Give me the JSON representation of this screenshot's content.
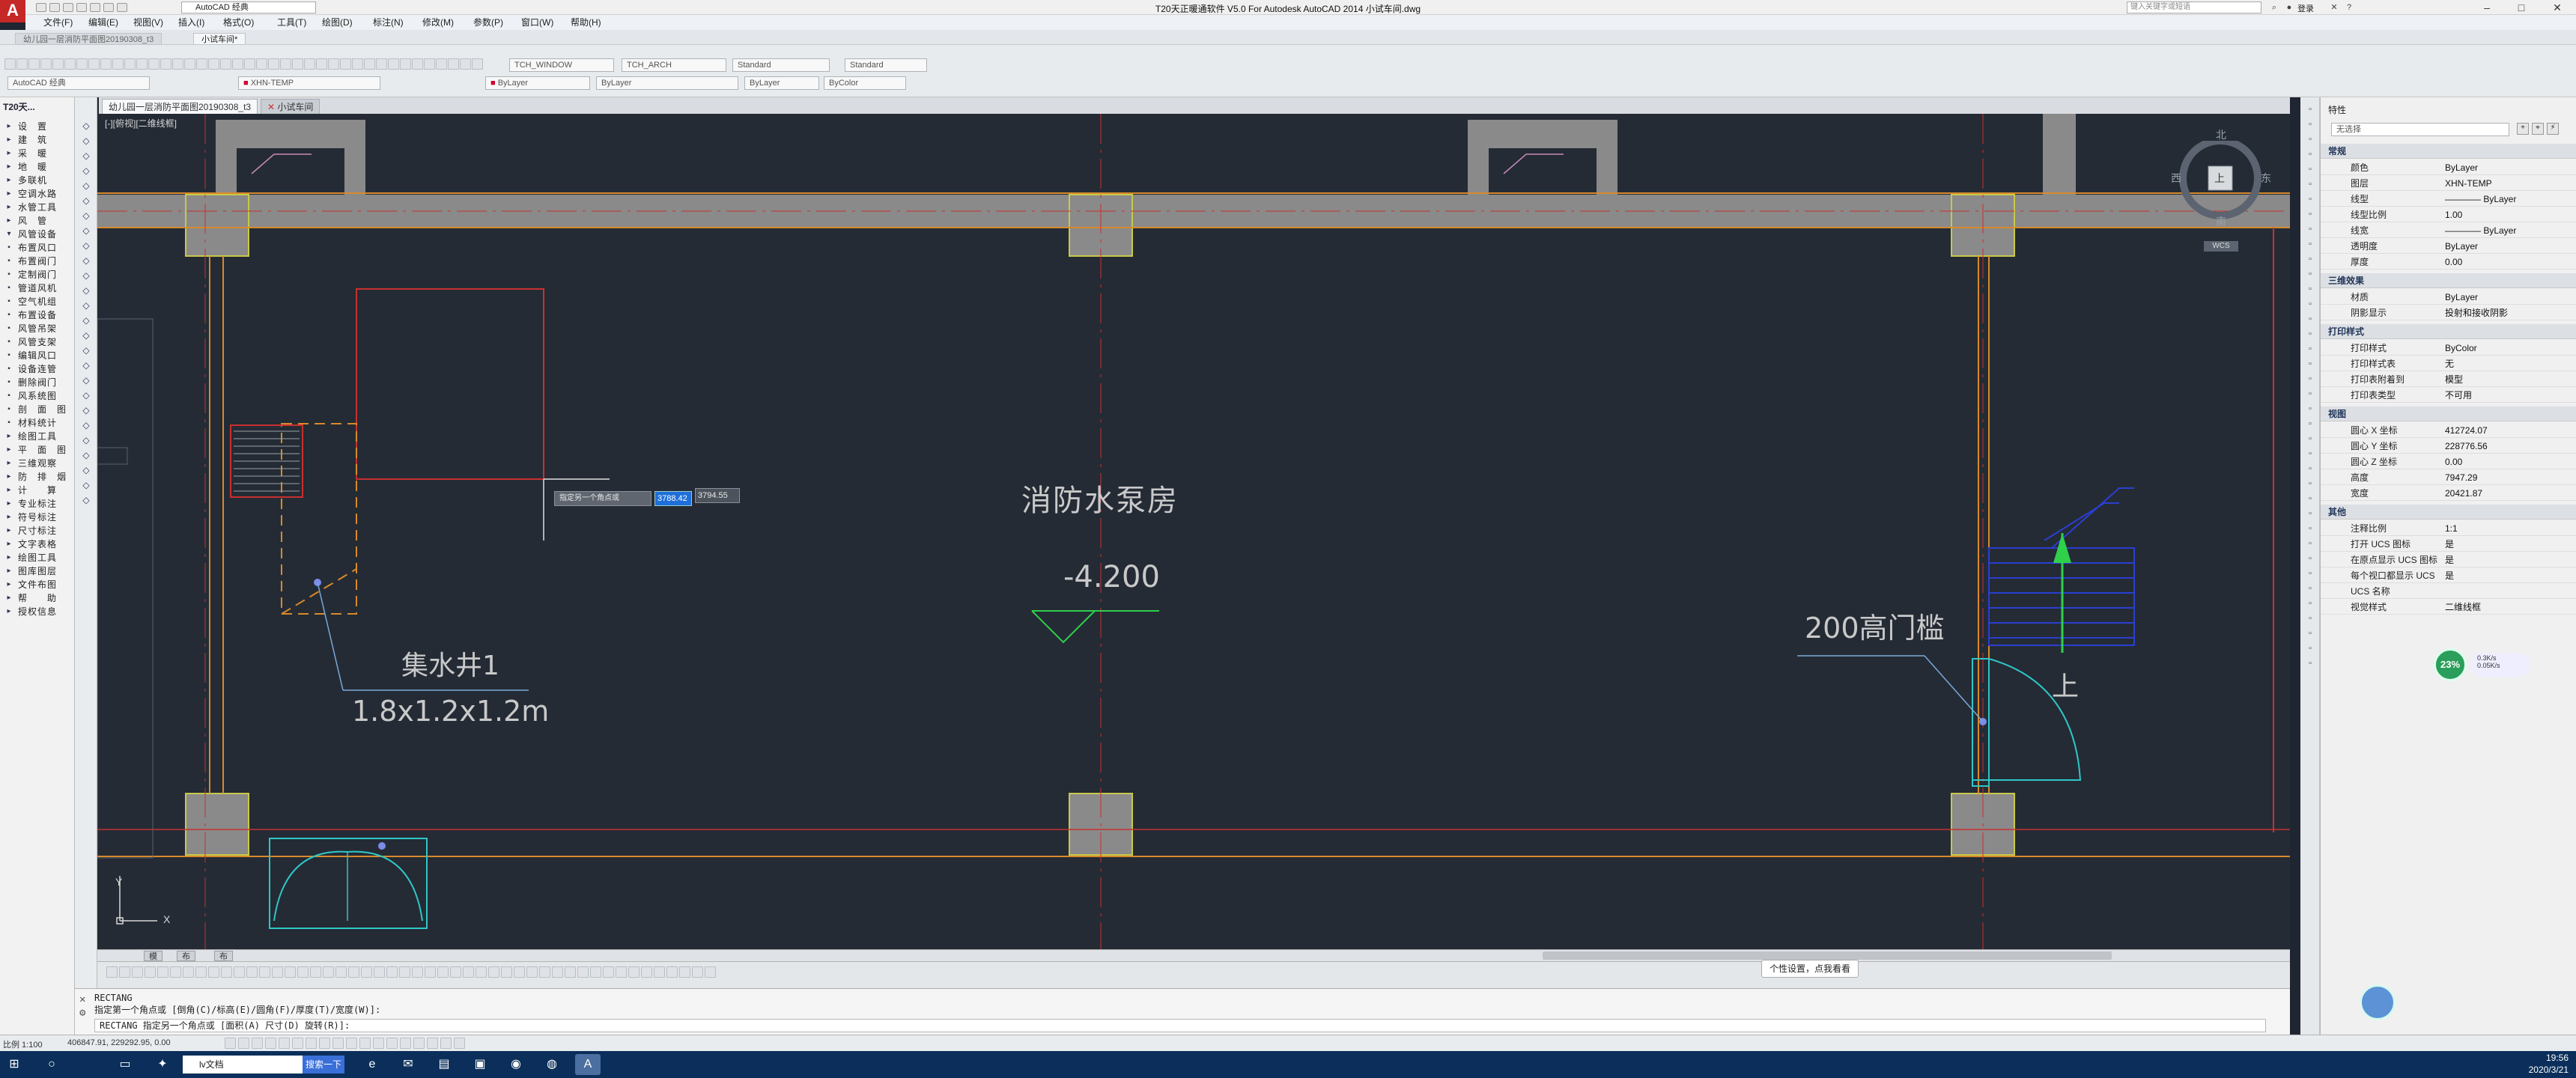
{
  "titlebar": {
    "app_label": "A",
    "workspace": "AutoCAD 经典",
    "title": "T20天正暖通软件 V5.0 For Autodesk AutoCAD 2014   小试车间.dwg",
    "search_placeholder": "键入关键字或短语",
    "sign_in": "登录"
  },
  "menu": [
    "文件(F)",
    "编辑(E)",
    "视图(V)",
    "插入(I)",
    "格式(O)",
    "工具(T)",
    "绘图(D)",
    "标注(N)",
    "修改(M)",
    "参数(P)",
    "窗口(W)",
    "帮助(H)"
  ],
  "file_tabs": [
    {
      "label": "幼儿园一层消防平面图20190308_t3",
      "active": false
    },
    {
      "label": "小试车间*",
      "active": true
    }
  ],
  "toolbars": {
    "workspace_dropdown": "AutoCAD 经典",
    "layer_dropdown": "XHN-TEMP",
    "textstyle_window": "TCH_WINDOW",
    "textstyle_arch": "TCH_ARCH",
    "dimstyle": "Standard",
    "tablestyle": "Standard",
    "color": "ByLayer",
    "linetype": "ByLayer",
    "lineweight": "ByLayer",
    "plotstyle": "ByColor"
  },
  "doc_tabs": [
    {
      "label": "幼儿园一层消防平面图20190308_t3",
      "active": true
    },
    {
      "label": "小试车间",
      "active": false
    }
  ],
  "left_panel": {
    "title": "T20天...",
    "items": [
      {
        "icon": "▸",
        "label": "设　置"
      },
      {
        "icon": "▸",
        "label": "建　筑"
      },
      {
        "icon": "▸",
        "label": "采　暖"
      },
      {
        "icon": "▸",
        "label": "地　暖"
      },
      {
        "icon": "▸",
        "label": "多联机"
      },
      {
        "icon": "▸",
        "label": "空调水路"
      },
      {
        "icon": "▸",
        "label": "水管工具"
      },
      {
        "icon": "▸",
        "label": "风　管"
      },
      {
        "icon": "▾",
        "label": "风管设备"
      },
      {
        "icon": "▪",
        "label": "布置风口"
      },
      {
        "icon": "▪",
        "label": "布置阀门"
      },
      {
        "icon": "▪",
        "label": "定制阀门"
      },
      {
        "icon": "▪",
        "label": "管道风机"
      },
      {
        "icon": "▪",
        "label": "空气机组"
      },
      {
        "icon": "▪",
        "label": "布置设备"
      },
      {
        "icon": "▪",
        "label": "风管吊架"
      },
      {
        "icon": "▪",
        "label": "风管支架"
      },
      {
        "icon": "▪",
        "label": "编辑风口"
      },
      {
        "icon": "▪",
        "label": "设备连管"
      },
      {
        "icon": "▪",
        "label": "删除阀门"
      },
      {
        "icon": "▪",
        "label": "风系统图"
      },
      {
        "icon": "▪",
        "label": "剖　面　图"
      },
      {
        "icon": "▪",
        "label": "材料统计"
      },
      {
        "icon": "▸",
        "label": "绘图工具"
      },
      {
        "icon": "▸",
        "label": "平　面　图"
      },
      {
        "icon": "▸",
        "label": "三维观察"
      },
      {
        "icon": "▸",
        "label": "防　排　烟"
      },
      {
        "icon": "▸",
        "label": "计　　算"
      },
      {
        "icon": "▸",
        "label": "专业标注"
      },
      {
        "icon": "▸",
        "label": "符号标注"
      },
      {
        "icon": "▸",
        "label": "尺寸标注"
      },
      {
        "icon": "▸",
        "label": "文字表格"
      },
      {
        "icon": "▸",
        "label": "绘图工具"
      },
      {
        "icon": "▸",
        "label": "图库图层"
      },
      {
        "icon": "▸",
        "label": "文件布图"
      },
      {
        "icon": "▸",
        "label": "帮　　助"
      },
      {
        "icon": "▸",
        "label": "授权信息"
      }
    ]
  },
  "canvas": {
    "view_label": "[-][俯视][二维线框]",
    "labels": {
      "room": "消防水泵房",
      "elevation": "-4.200",
      "pit_name": "集水井1",
      "pit_size": "1.8x1.2x1.2m",
      "threshold": "200高门槛",
      "stair_up": "上"
    },
    "dynamic_input": {
      "prompt": "指定另一个角点或",
      "x_value": "3788.42",
      "y_value": "3794.55"
    },
    "viewcube": {
      "north": "北",
      "south": "南",
      "east": "东",
      "west": "西",
      "top": "上",
      "wcs": "WCS"
    },
    "ucs": {
      "x": "X",
      "y": "Y"
    }
  },
  "layout_tabs": [
    "模型",
    "布局1",
    "布局2"
  ],
  "command": {
    "line1": "RECTANG",
    "line2": "指定第一个角点或 [倒角(C)/标高(E)/圆角(F)/厚度(T)/宽度(W)]:",
    "prompt_prefix": "RECTANG 指定另一个角点或 [面积(A) 尺寸(D) 旋转(R)]:"
  },
  "status": {
    "scale": "比例 1:100",
    "coords": "406847.91, 229292.95, 0.00",
    "hint_chip": "个性设置，点我看看"
  },
  "properties": {
    "selection": "无选择",
    "sections": [
      {
        "title": "常规",
        "rows": [
          [
            "颜色",
            "ByLayer"
          ],
          [
            "图层",
            "XHN-TEMP"
          ],
          [
            "线型",
            "———— ByLayer"
          ],
          [
            "线型比例",
            "1.00"
          ],
          [
            "线宽",
            "———— ByLayer"
          ],
          [
            "透明度",
            "ByLayer"
          ],
          [
            "厚度",
            "0.00"
          ]
        ]
      },
      {
        "title": "三维效果",
        "rows": [
          [
            "材质",
            "ByLayer"
          ],
          [
            "阴影显示",
            "投射和接收阴影"
          ]
        ]
      },
      {
        "title": "打印样式",
        "rows": [
          [
            "打印样式",
            "ByColor"
          ],
          [
            "打印样式表",
            "无"
          ],
          [
            "打印表附着到",
            "模型"
          ],
          [
            "打印表类型",
            "不可用"
          ]
        ]
      },
      {
        "title": "视图",
        "rows": [
          [
            "圆心 X 坐标",
            "412724.07"
          ],
          [
            "圆心 Y 坐标",
            "228776.56"
          ],
          [
            "圆心 Z 坐标",
            "0.00"
          ],
          [
            "高度",
            "7947.29"
          ],
          [
            "宽度",
            "20421.87"
          ]
        ]
      },
      {
        "title": "其他",
        "rows": [
          [
            "注释比例",
            "1:1"
          ],
          [
            "打开 UCS 图标",
            "是"
          ],
          [
            "在原点显示 UCS 图标",
            "是"
          ],
          [
            "每个视口都显示 UCS",
            "是"
          ],
          [
            "UCS 名称",
            ""
          ],
          [
            "视觉样式",
            "二维线框"
          ]
        ]
      }
    ]
  },
  "hud": {
    "percent": "23%",
    "up": "0.3K/s",
    "down": "0.05K/s"
  },
  "taskbar": {
    "search_text": "lv文档",
    "search_button": "搜索一下",
    "time": "19:56",
    "date": "2020/3/21"
  },
  "colors": {
    "canvas_bg": "#242b35",
    "wall": "#8a8a8a",
    "orange": "#d88a2a",
    "red": "#c83030",
    "cyan": "#2fc7c7",
    "blue": "#2a3fd0",
    "green": "#2fd04a",
    "text": "#c9c9c9"
  }
}
